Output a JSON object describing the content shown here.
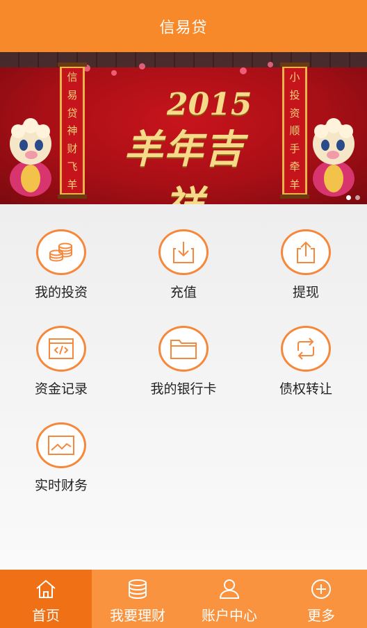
{
  "header": {
    "title": "信易贷"
  },
  "banner": {
    "left_scroll": [
      "信",
      "易",
      "贷",
      "神",
      "财",
      "飞",
      "羊"
    ],
    "right_scroll": [
      "小",
      "投",
      "资",
      "顺",
      "手",
      "牵",
      "羊"
    ],
    "year": "2015",
    "calligraphy": "羊年吉祥"
  },
  "menu": {
    "items": [
      {
        "label": "我的投资",
        "icon": "coins-icon"
      },
      {
        "label": "充值",
        "icon": "download-icon"
      },
      {
        "label": "提现",
        "icon": "upload-icon"
      },
      {
        "label": "资金记录",
        "icon": "code-document-icon"
      },
      {
        "label": "我的银行卡",
        "icon": "folder-icon"
      },
      {
        "label": "债权转让",
        "icon": "transfer-arrows-icon"
      },
      {
        "label": "实时财务",
        "icon": "line-chart-icon"
      }
    ]
  },
  "tabbar": {
    "tabs": [
      {
        "label": "首页",
        "icon": "home-icon",
        "active": true
      },
      {
        "label": "我要理财",
        "icon": "database-icon",
        "active": false
      },
      {
        "label": "账户中心",
        "icon": "user-icon",
        "active": false
      },
      {
        "label": "更多",
        "icon": "plus-circle-icon",
        "active": false
      }
    ]
  },
  "colors": {
    "accent": "#f7892a",
    "tab_active": "#f07015",
    "icon_stroke": "#f5883a"
  }
}
